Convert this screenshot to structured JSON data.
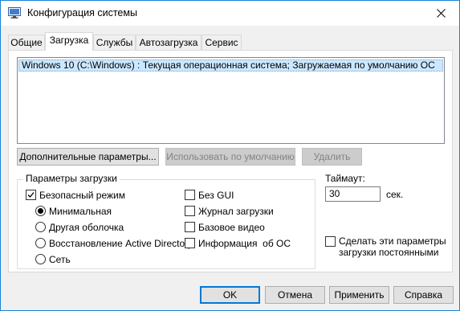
{
  "window": {
    "title": "Конфигурация системы",
    "accent_color": "#1883d7",
    "icon": "msconfig-app-icon",
    "close_icon": "close-icon"
  },
  "tabs": [
    {
      "label": "Общие",
      "active": false
    },
    {
      "label": "Загрузка",
      "active": true
    },
    {
      "label": "Службы",
      "active": false
    },
    {
      "label": "Автозагрузка",
      "active": false
    },
    {
      "label": "Сервис",
      "active": false
    }
  ],
  "os_list": {
    "items": [
      "Windows 10 (C:\\Windows) : Текущая операционная система; Загружаемая по умолчанию ОС"
    ],
    "selected_index": 0,
    "selection_color": "#cce8ff"
  },
  "list_buttons": {
    "advanced": "Дополнительные параметры...",
    "set_default": "Использовать по умолчанию",
    "delete": "Удалить"
  },
  "boot_options": {
    "title": "Параметры загрузки",
    "safe_boot": {
      "label": "Безопасный режим",
      "checked": true
    },
    "radios": [
      {
        "label": "Минимальная",
        "checked": true
      },
      {
        "label": "Другая оболочка",
        "checked": false
      },
      {
        "label": "Восстановление Active Directory",
        "checked": false
      },
      {
        "label": "Сеть",
        "checked": false
      }
    ],
    "checks": [
      {
        "label": "Без GUI",
        "checked": false
      },
      {
        "label": "Журнал загрузки",
        "checked": false
      },
      {
        "label": "Базовое видео",
        "checked": false
      },
      {
        "label": "Информация  об ОС",
        "checked": false
      }
    ]
  },
  "timeout": {
    "label": "Таймаут:",
    "value": "30",
    "unit": "сек."
  },
  "persistent": {
    "label_line1": "Сделать эти параметры",
    "label_line2": "загрузки постоянными",
    "checked": false
  },
  "footer_buttons": {
    "ok": "OK",
    "cancel": "Отмена",
    "apply": "Применить",
    "help": "Справка"
  }
}
